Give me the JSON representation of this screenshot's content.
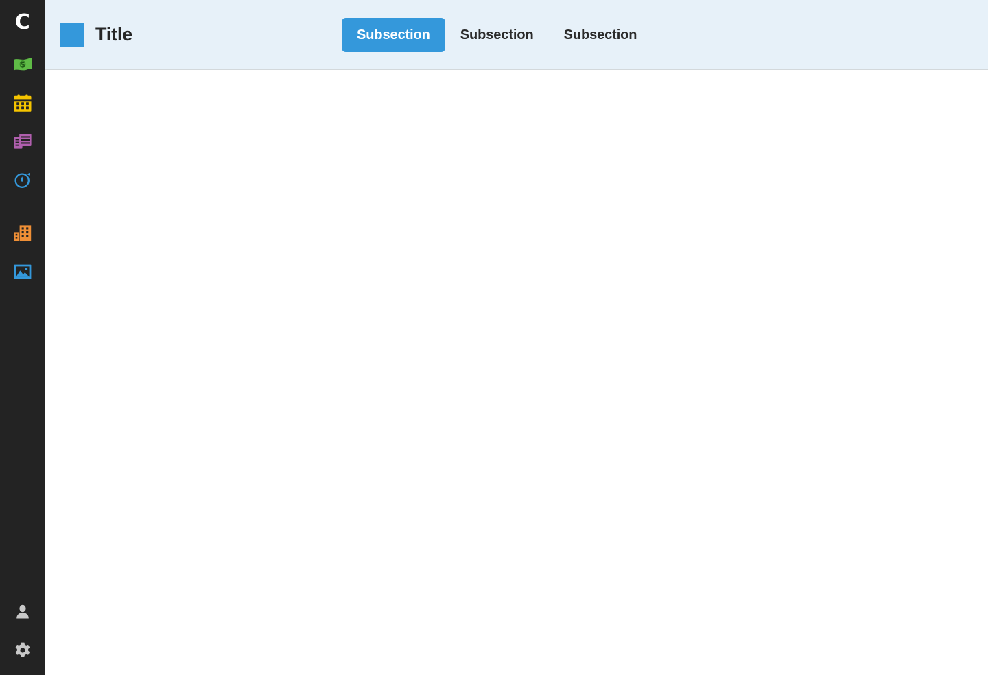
{
  "app": {
    "logo_glyph": "C",
    "logo_name": "brand-logo-c"
  },
  "sidebar": {
    "background": "#232323",
    "items": [
      {
        "icon": "money-bill-icon",
        "color": "#5fbb46",
        "label": "Money"
      },
      {
        "icon": "calendar-icon",
        "color": "#f5c400",
        "label": "Calendar"
      },
      {
        "icon": "documents-icon",
        "color": "#b05fae",
        "label": "Documents"
      },
      {
        "icon": "stopwatch-icon",
        "color": "#3498db",
        "label": "Timer"
      }
    ],
    "items_secondary": [
      {
        "icon": "buildings-icon",
        "color": "#ef8f36",
        "label": "Companies"
      },
      {
        "icon": "image-icon",
        "color": "#3498db",
        "label": "Images"
      }
    ],
    "items_bottom": [
      {
        "icon": "user-icon",
        "color": "#c8c8c8",
        "label": "Profile"
      },
      {
        "icon": "gear-icon",
        "color": "#c8c8c8",
        "label": "Settings"
      }
    ]
  },
  "header": {
    "background": "#e7f1f9",
    "accent": "#3498db",
    "square_color": "#3498db",
    "title": "Title",
    "tabs": [
      {
        "label": "Subsection",
        "active": true
      },
      {
        "label": "Subsection",
        "active": false
      },
      {
        "label": "Subsection",
        "active": false
      }
    ]
  },
  "main": {
    "background": "#ffffff",
    "content": ""
  }
}
